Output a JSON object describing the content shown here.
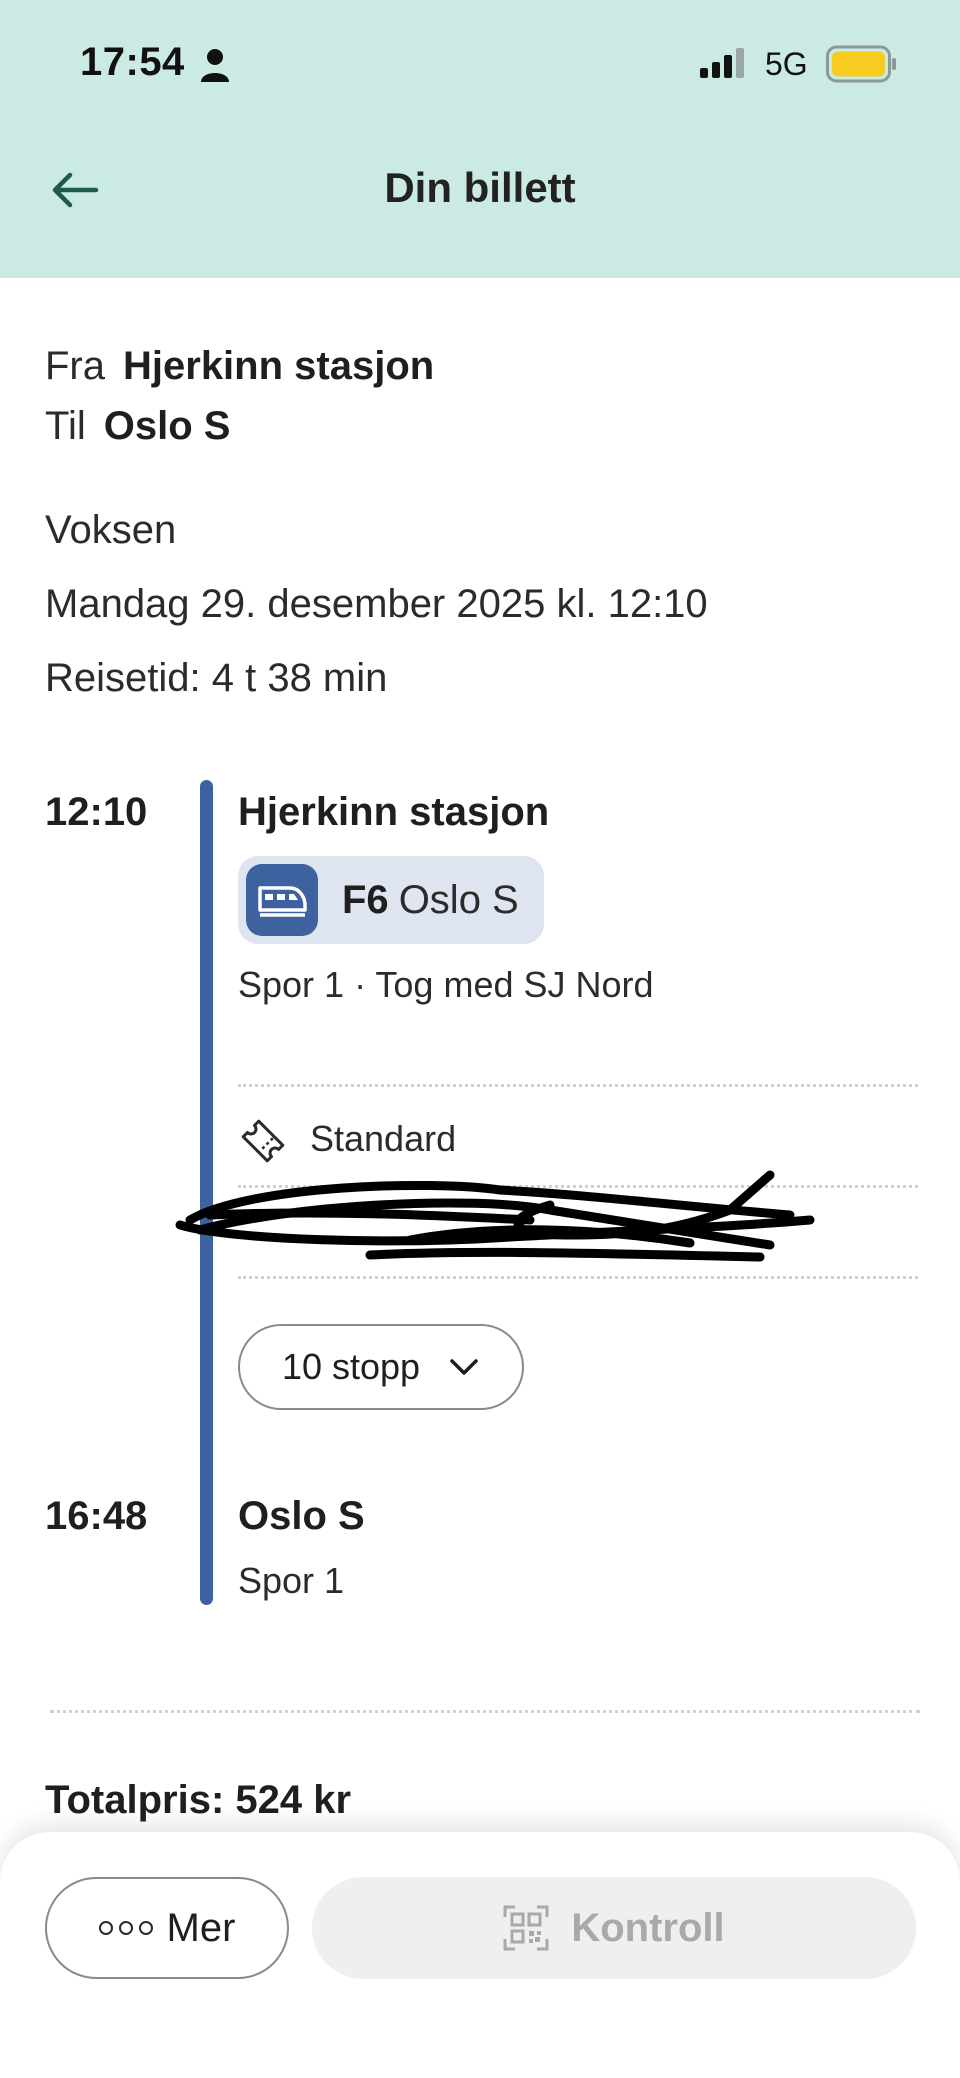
{
  "status_bar": {
    "time": "17:54",
    "network": "5G"
  },
  "header": {
    "title": "Din billett"
  },
  "summary": {
    "from_label": "Fra",
    "from_value": "Hjerkinn stasjon",
    "to_label": "Til",
    "to_value": "Oslo S",
    "passenger": "Voksen",
    "date": "Mandag 29. desember 2025 kl. 12:10",
    "travel_time": "Reisetid: 4 t 38 min"
  },
  "departure": {
    "time": "12:10",
    "station": "Hjerkinn stasjon",
    "line_code": "F6",
    "line_destination": "Oslo S",
    "details": "Spor 1 · Tog med SJ Nord",
    "ticket_class": "Standard",
    "stops_label": "10 stopp"
  },
  "arrival": {
    "time": "16:48",
    "station": "Oslo S",
    "platform": "Spor 1"
  },
  "total": "Totalpris: 524 kr",
  "actions": {
    "more_label": "Mer",
    "control_label": "Kontroll"
  },
  "colors": {
    "header_bg": "#cceae4",
    "accent": "#3e62a0",
    "pill_bg": "#dfe5f0",
    "disabled_text": "#a9a9a9"
  },
  "icons": [
    "person-icon",
    "signal-icon",
    "battery-icon",
    "back-arrow-icon",
    "train-icon",
    "ticket-icon",
    "chevron-down-icon",
    "more-dots-icon",
    "qr-code-icon"
  ]
}
